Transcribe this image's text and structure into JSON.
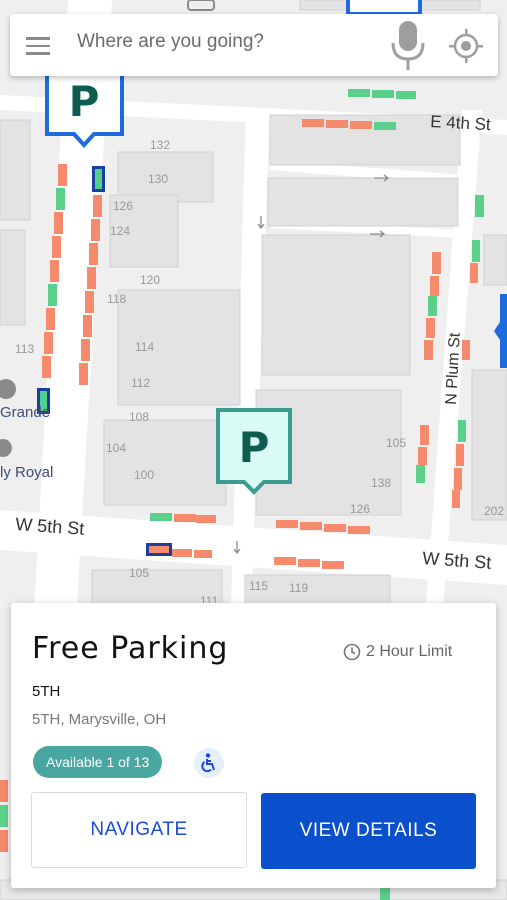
{
  "search": {
    "placeholder": "Where are you going?"
  },
  "map": {
    "streets": [
      "E 4th St",
      "N Plum St",
      "W 5th St",
      "W 5th St"
    ],
    "building_numbers": [
      "132",
      "130",
      "126",
      "124",
      "120",
      "118",
      "114",
      "112",
      "108",
      "104",
      "100",
      "113",
      "105",
      "138",
      "126",
      "202",
      "105",
      "111",
      "115",
      "119"
    ],
    "poi_labels": [
      "Grande",
      "ly Royal"
    ],
    "selected_marker_label": "P",
    "marker_label": "P"
  },
  "card": {
    "title": "Free Parking",
    "time_limit": "2 Hour Limit",
    "street": "5TH",
    "address": "5TH, Marysville, OH",
    "availability": "Available  1 of 13",
    "navigate_label": "NAVIGATE",
    "details_label": "VIEW DETAILS"
  },
  "colors": {
    "accent_blue": "#0a4fcc",
    "teal": "#4aa6a1",
    "available_green": "#5bd08a",
    "occupied_orange": "#f58a6c",
    "marker_blue": "#1e6be0"
  }
}
